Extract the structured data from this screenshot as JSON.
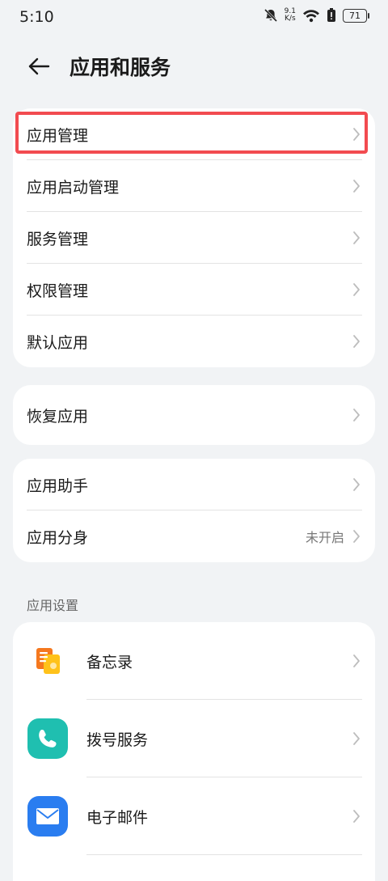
{
  "status_bar": {
    "time": "5:10",
    "speed_value": "9.1",
    "speed_unit": "K/s",
    "battery": "71"
  },
  "header": {
    "title": "应用和服务"
  },
  "group1": {
    "items": [
      {
        "label": "应用管理"
      },
      {
        "label": "应用启动管理"
      },
      {
        "label": "服务管理"
      },
      {
        "label": "权限管理"
      },
      {
        "label": "默认应用"
      }
    ]
  },
  "group2": {
    "items": [
      {
        "label": "恢复应用"
      }
    ]
  },
  "group3": {
    "items": [
      {
        "label": "应用助手"
      },
      {
        "label": "应用分身",
        "value": "未开启"
      }
    ]
  },
  "section_title": "应用设置",
  "app_settings": {
    "items": [
      {
        "label": "备忘录",
        "icon": "memo-icon"
      },
      {
        "label": "拨号服务",
        "icon": "phone-icon"
      },
      {
        "label": "电子邮件",
        "icon": "mail-icon"
      }
    ]
  },
  "colors": {
    "highlight": "#f24b50",
    "background": "#f1f3f5",
    "phone_icon": "#1fbfb0",
    "mail_icon": "#2a7df0",
    "memo_icon": "#f5a623"
  }
}
